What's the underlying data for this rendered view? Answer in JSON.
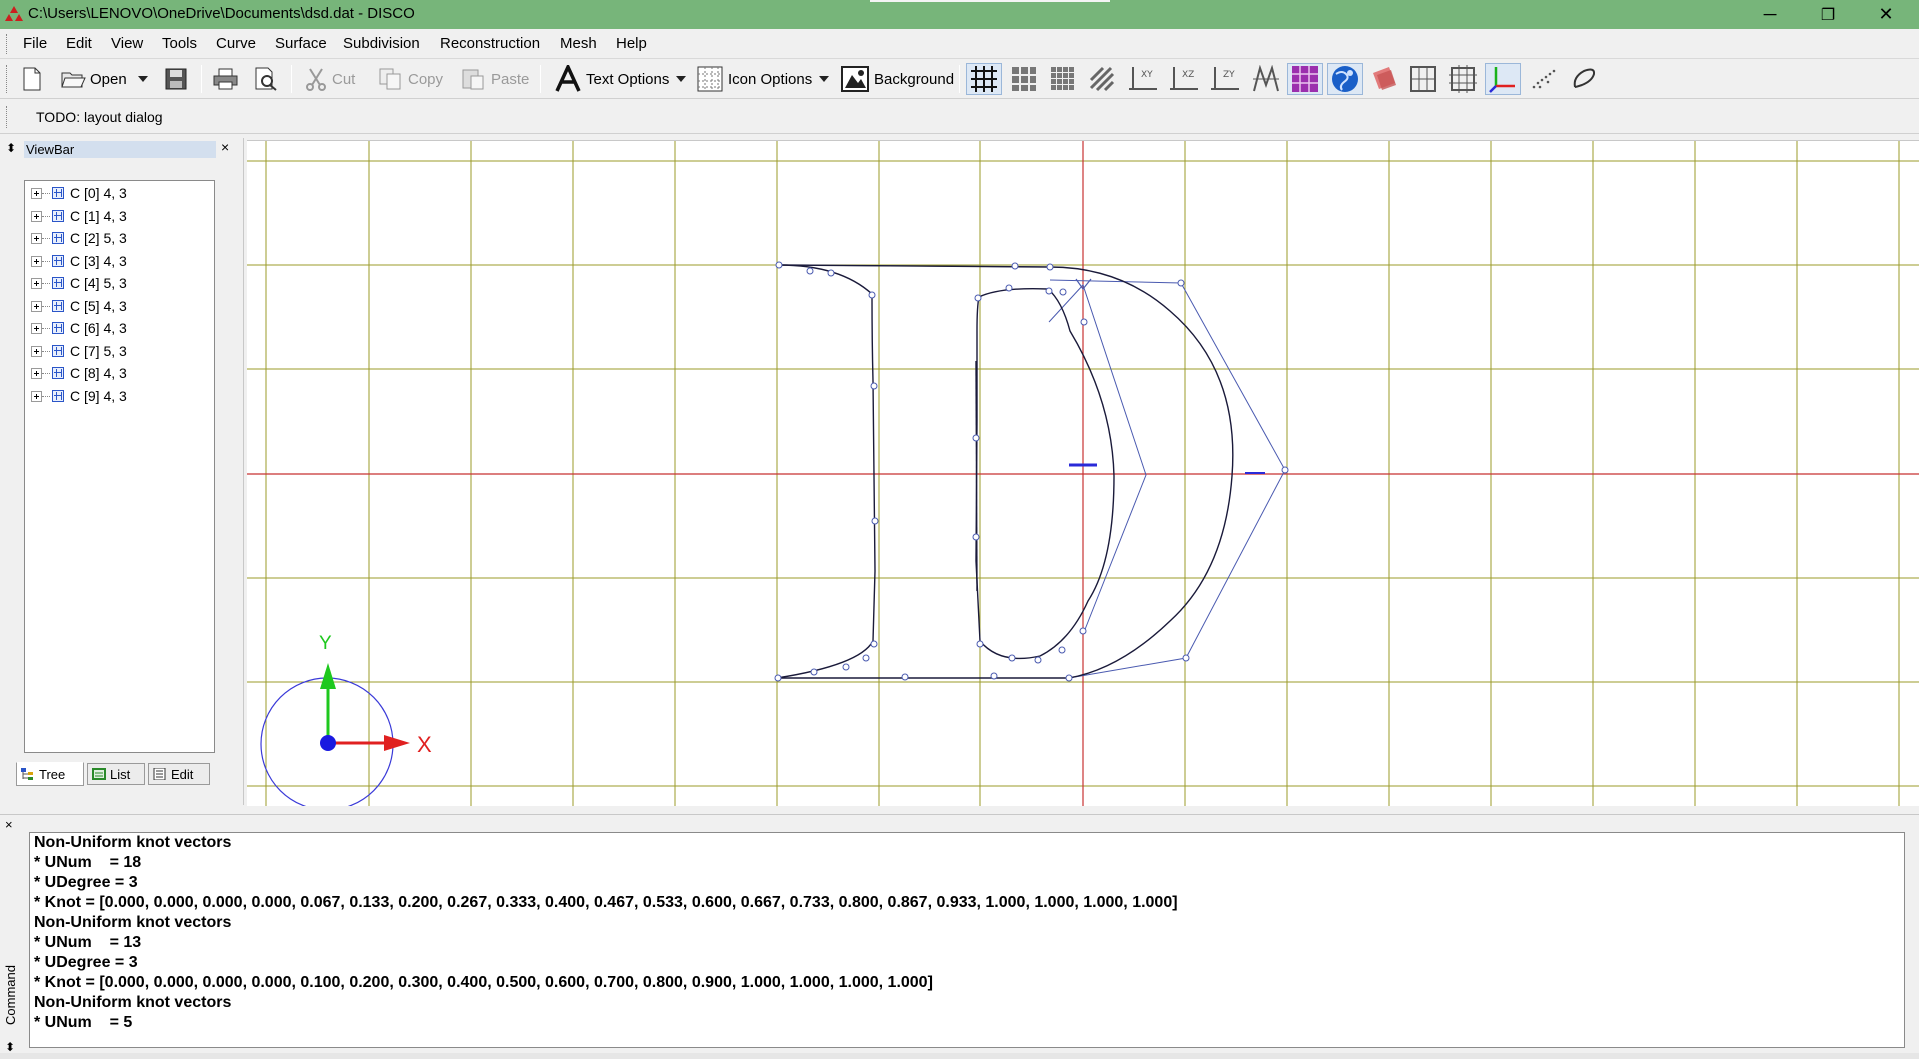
{
  "window": {
    "title": "C:\\Users\\LENOVO\\OneDrive\\Documents\\dsd.dat - DISCO",
    "minimize": "─",
    "restore": "❐",
    "close": "✕"
  },
  "menu": [
    "File",
    "Edit",
    "View",
    "Tools",
    "Curve",
    "Surface",
    "Subdivision",
    "Reconstruction",
    "Mesh",
    "Help"
  ],
  "toolbar": {
    "open": "Open",
    "cut": "Cut",
    "copy": "Copy",
    "paste": "Paste",
    "text_options": "Text Options",
    "icon_options": "Icon Options",
    "background": "Background"
  },
  "status": {
    "todo": "TODO: layout dialog"
  },
  "viewbar": {
    "title": "ViewBar",
    "close": "×",
    "items": [
      "C [0] 4, 3",
      "C [1] 4, 3",
      "C [2] 5, 3",
      "C [3] 4, 3",
      "C [4] 5, 3",
      "C [5] 4, 3",
      "C [6] 4, 3",
      "C [7] 5, 3",
      "C [8] 4, 3",
      "C [9] 4, 3"
    ],
    "tabs": [
      "Tree",
      "List",
      "Edit"
    ]
  },
  "viewport": {
    "axis_y": "Y",
    "axis_x": "X",
    "colors": {
      "grid": "#9b9b2a",
      "axis": "#c83232",
      "curve": "#1a1a3a",
      "control_polygon": "#4a5ab0",
      "gizmo_y": "#1ec81e",
      "gizmo_x": "#e02020",
      "gizmo_circle": "#3a3ad8"
    }
  },
  "command": {
    "label": "Command",
    "close": "×",
    "lines": [
      "Non-Uniform knot vectors",
      "* UNum    = 18",
      "* UDegree = 3",
      "* Knot = [0.000, 0.000, 0.000, 0.000, 0.067, 0.133, 0.200, 0.267, 0.333, 0.400, 0.467, 0.533, 0.600, 0.667, 0.733, 0.800, 0.867, 0.933, 1.000, 1.000, 1.000, 1.000]",
      "Non-Uniform knot vectors",
      "* UNum    = 13",
      "* UDegree = 3",
      "* Knot = [0.000, 0.000, 0.000, 0.000, 0.100, 0.200, 0.300, 0.400, 0.500, 0.600, 0.700, 0.800, 0.900, 1.000, 1.000, 1.000, 1.000]",
      "Non-Uniform knot vectors",
      "* UNum    = 5"
    ]
  }
}
